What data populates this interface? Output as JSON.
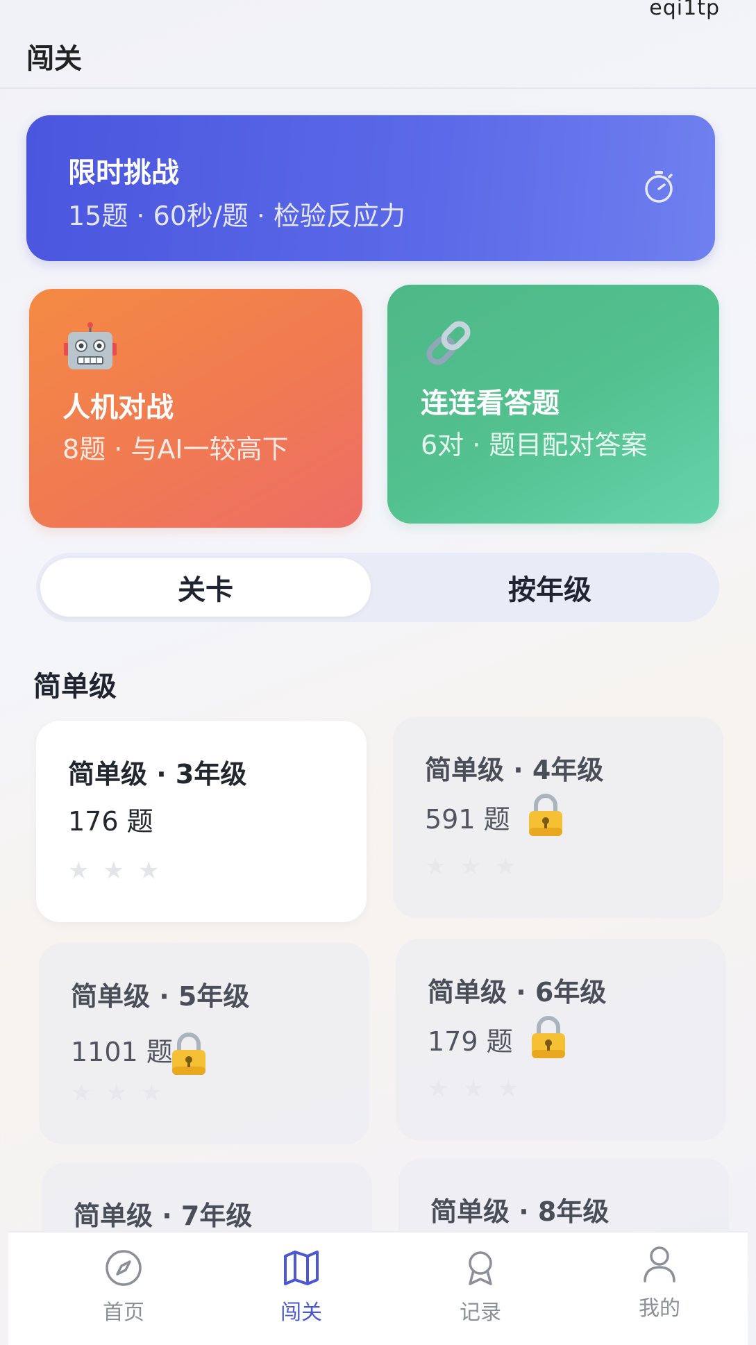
{
  "watermark": "eqi1tp",
  "page_title": "闯关",
  "challenge": {
    "title": "限时挑战",
    "subtitle": "15题 · 60秒/题 · 检验反应力",
    "icon": "stopwatch-icon"
  },
  "modes": [
    {
      "title": "人机对战",
      "subtitle": "8题 · 与AI一较高下",
      "icon": "robot-icon"
    },
    {
      "title": "连连看答题",
      "subtitle": "6对 · 题目配对答案",
      "icon": "link-icon"
    }
  ],
  "tabs": {
    "active": "关卡",
    "inactive": "按年级"
  },
  "section_title": "简单级",
  "levels": [
    {
      "title": "简单级 · 3年级",
      "count": "176 题",
      "locked": false,
      "stars": 3
    },
    {
      "title": "简单级 · 4年级",
      "count": "591 题",
      "locked": true,
      "stars": 3
    },
    {
      "title": "简单级 · 5年级",
      "count": "1101 题",
      "locked": true,
      "stars": 3
    },
    {
      "title": "简单级 · 6年级",
      "count": "179 题",
      "locked": true,
      "stars": 3
    },
    {
      "title": "简单级 · 7年级"
    },
    {
      "title": "简单级 · 8年级"
    }
  ],
  "nav": [
    {
      "label": "首页",
      "icon": "compass-icon",
      "active": false
    },
    {
      "label": "闯关",
      "icon": "map-icon",
      "active": true
    },
    {
      "label": "记录",
      "icon": "badge-icon",
      "active": false
    },
    {
      "label": "我的",
      "icon": "user-icon",
      "active": false
    }
  ],
  "colors": {
    "challenge": "#5361e4",
    "robot_card": "#f17e4e",
    "link_card": "#55c292",
    "nav_active": "#4b57d4",
    "nav_inactive": "#8b8f98"
  }
}
